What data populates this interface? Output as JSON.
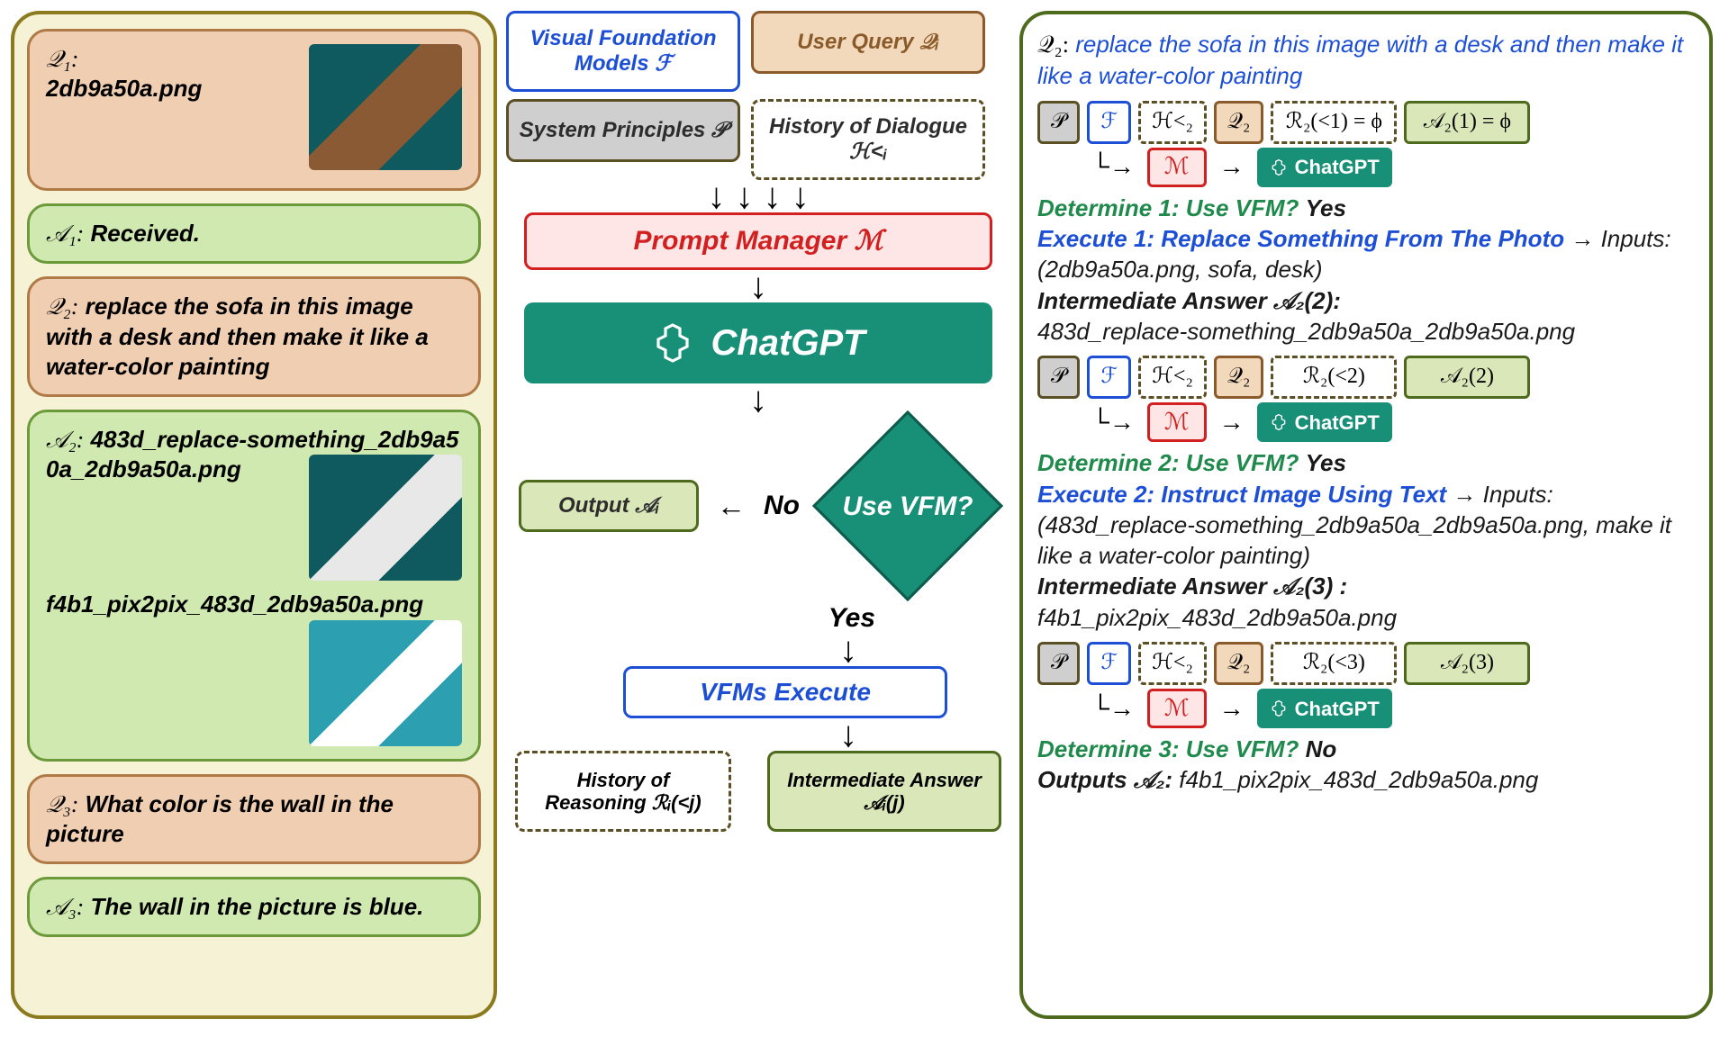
{
  "left": {
    "q1_label": "𝒬₁:",
    "q1_file": "2db9a50a.png",
    "a1_label": "𝒜₁:",
    "a1_text": "Received.",
    "q2_label": "𝒬₂:",
    "q2_text": "replace the sofa in this image with a desk and then make it like a water-color painting",
    "a2_label": "𝒜₂:",
    "a2_file1": "483d_replace-something_2db9a50a_2db9a50a.png",
    "a2_file2": "f4b1_pix2pix_483d_2db9a50a.png",
    "q3_label": "𝒬₃:",
    "q3_text": "What color is the wall in the picture",
    "a3_label": "𝒜₃:",
    "a3_text": "The wall in the picture is blue."
  },
  "mid": {
    "vfm_models": "Visual Foundation Models ℱ",
    "user_query": "User Query 𝒬ᵢ",
    "sys_principles": "System Principles 𝒫",
    "history_dialogue": "History of Dialogue ℋ<ᵢ",
    "prompt_manager": "Prompt  Manager  ℳ",
    "chatgpt": "ChatGPT",
    "decision": "Use VFM?",
    "no": "No",
    "yes": "Yes",
    "output_a": "Output 𝒜ᵢ",
    "vfm_execute": "VFMs Execute",
    "history_reasoning": "History of Reasoning ℛᵢ(<j)",
    "intermediate_answer": "Intermediate Answer 𝒜ᵢ(j)"
  },
  "right": {
    "q2_prefix": "𝒬₂:",
    "q2_text": "replace the sofa in this image with a desk and then make it like a water-color painting",
    "tok_p": "𝒫",
    "tok_f": "ℱ",
    "tok_h": "ℋ<₂",
    "tok_q": "𝒬₂",
    "tok_r1": "ℛ₂(<1) = ϕ",
    "tok_a1": "𝒜₂(1) = ϕ",
    "tok_m": "ℳ",
    "chatgpt": "ChatGPT",
    "det1_lbl": "Determine 1",
    "det1_txt": ": Use VFM?",
    "det1_ans": "Yes",
    "exe1_lbl": "Execute 1",
    "exe1_txt": ": Replace Something From The Photo",
    "exe1_in": " → Inputs: (2db9a50a.png, sofa, desk)",
    "ia2_lbl": "Intermediate Answer 𝒜₂(2):",
    "ia2_val": "483d_replace-something_2db9a50a_2db9a50a.png",
    "tok_r2": "ℛ₂(<2)",
    "tok_a2": "𝒜₂(2)",
    "det2_lbl": "Determine 2",
    "det2_ans": "Yes",
    "exe2_lbl": "Execute 2",
    "exe2_txt": ": Instruct Image Using Text",
    "exe2_in": "→ Inputs: (483d_replace-something_2db9a50a_2db9a50a.png, make it like a water-color painting)",
    "ia3_lbl": "Intermediate Answer 𝒜₂(3) :",
    "ia3_val": "f4b1_pix2pix_483d_2db9a50a.png",
    "tok_r3": "ℛ₂(<3)",
    "tok_a3": "𝒜₂(3)",
    "det3_lbl": "Determine 3",
    "det3_ans": "No",
    "out_lbl": "Outputs 𝒜₂:",
    "out_val": "f4b1_pix2pix_483d_2db9a50a.png"
  }
}
